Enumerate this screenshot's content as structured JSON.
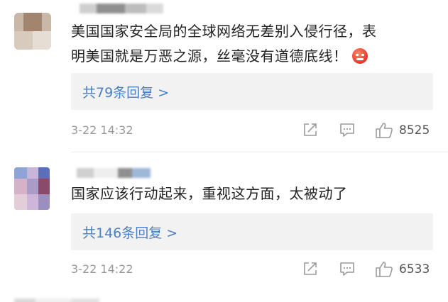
{
  "comments": [
    {
      "text_line1": "美国国家安全局的全球网络无差别入侵行径，表",
      "text_line2": "明美国就是万恶之源，丝毫没有道德底线！",
      "reply_label": "共79条回复 >",
      "timestamp": "3-22 14:32",
      "like_count": "8525"
    },
    {
      "text_line1": "国家应该行动起来，重视这方面，太被动了",
      "reply_label": "共146条回复 >",
      "timestamp": "3-22 14:22",
      "like_count": "6533"
    }
  ],
  "icons": {
    "share": "share-icon",
    "comment": "comment-icon",
    "like": "like-icon",
    "emoji": "angry-emoji-icon"
  },
  "colors": {
    "link": "#4a7fc1",
    "reply_bg": "#f2f2f2",
    "text": "#222222",
    "meta": "#999999"
  }
}
